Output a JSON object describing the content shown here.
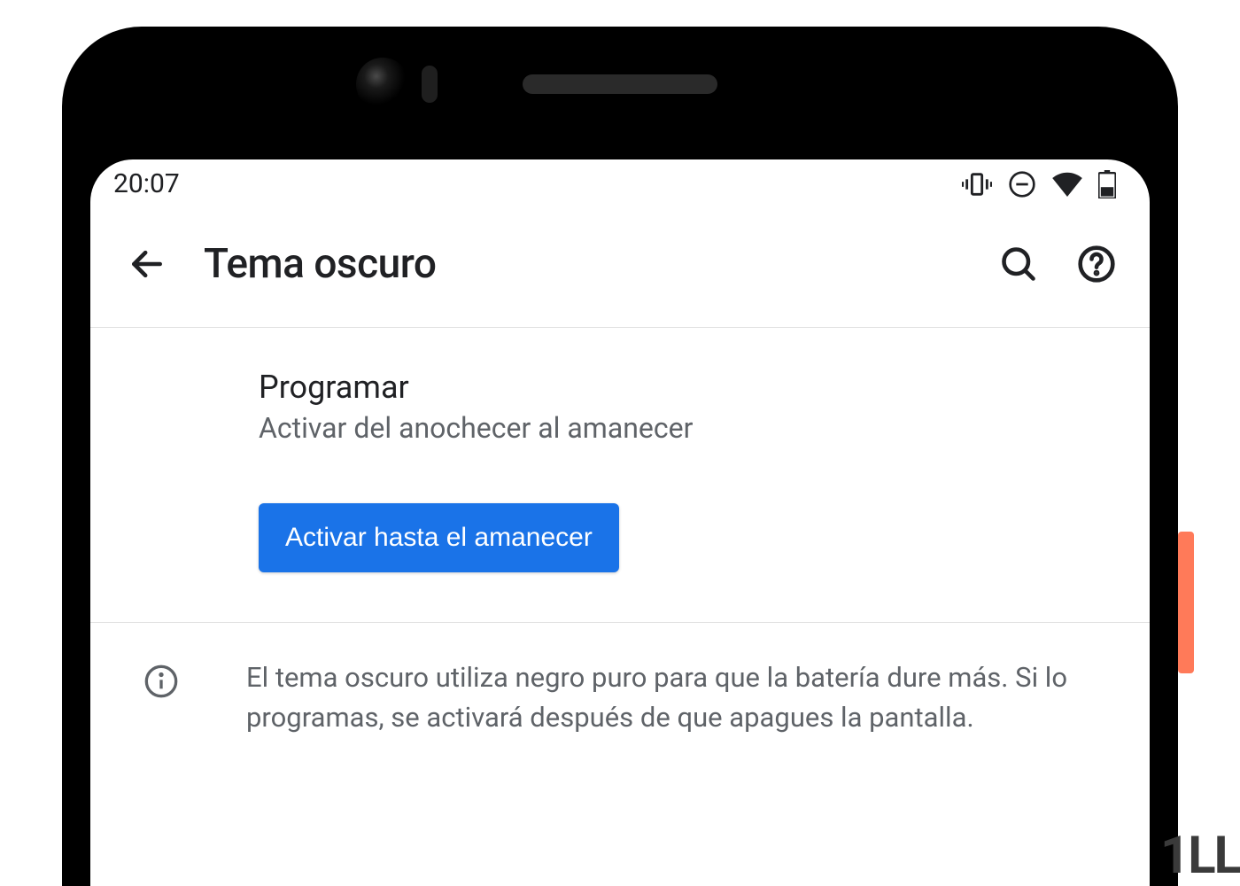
{
  "status_bar": {
    "time": "20:07"
  },
  "app_bar": {
    "title": "Tema oscuro"
  },
  "setting": {
    "title": "Programar",
    "subtitle": "Activar del anochecer al amanecer"
  },
  "action": {
    "button_label": "Activar hasta el amanecer"
  },
  "info": {
    "text": "El tema oscuro utiliza negro puro para que la batería dure más. Si lo programas, se activará después de que apagues la pantalla."
  },
  "watermark": "1LL",
  "colors": {
    "primary": "#1a73e8",
    "text_primary": "#202124",
    "text_secondary": "#5f6368"
  }
}
